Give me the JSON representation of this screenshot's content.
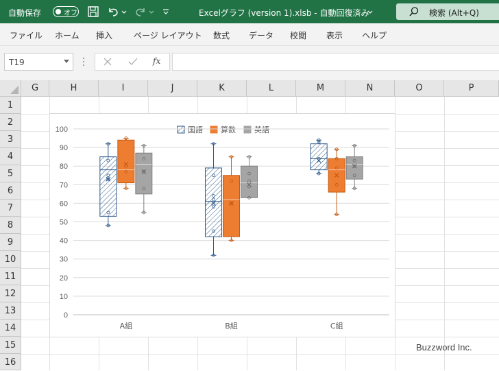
{
  "titlebar": {
    "autosave_label": "自動保存",
    "autosave_state": "オフ",
    "file_title": "Excelグラフ (version 1).xlsb  -  自動回復済み",
    "search_label": "検索 (Alt+Q)"
  },
  "menu": [
    "ファイル",
    "ホーム",
    "挿入",
    "ページ レイアウト",
    "数式",
    "データ",
    "校閲",
    "表示",
    "ヘルプ"
  ],
  "formula_bar": {
    "name_box": "T19",
    "fx_label": "fx",
    "formula": ""
  },
  "columns": [
    "G",
    "H",
    "I",
    "J",
    "K",
    "L",
    "M",
    "N",
    "O",
    "P"
  ],
  "rows": [
    "1",
    "2",
    "3",
    "4",
    "5",
    "6",
    "7",
    "8",
    "9",
    "10",
    "11",
    "12",
    "13",
    "14",
    "15",
    "16"
  ],
  "chart_data": {
    "type": "boxplot",
    "categories": [
      "A組",
      "B組",
      "C組"
    ],
    "ylim": [
      0,
      100
    ],
    "yticks": [
      "0",
      "10",
      "20",
      "30",
      "40",
      "50",
      "60",
      "70",
      "80",
      "90",
      "100"
    ],
    "legend_position": "top",
    "grid": true,
    "series": [
      {
        "name": "国語",
        "color": "#2e5a8a",
        "pattern": "hatch",
        "boxes": [
          {
            "min": 48,
            "q1": 53,
            "median": 78,
            "q3": 85,
            "max": 92,
            "mean": 73,
            "points": [
              48,
              55,
              73,
              75,
              83,
              92
            ]
          },
          {
            "min": 32,
            "q1": 42,
            "median": 61,
            "q3": 79,
            "max": 92,
            "mean": 60,
            "points": [
              32,
              45,
              58,
              62,
              64,
              75,
              92
            ]
          },
          {
            "min": 76,
            "q1": 78,
            "median": 84,
            "q3": 92,
            "max": 94,
            "mean": 83,
            "points": [
              76,
              84,
              93,
              94
            ]
          }
        ]
      },
      {
        "name": "算数",
        "color": "#ed7d31",
        "pattern": "solid",
        "boxes": [
          {
            "min": 68,
            "q1": 71,
            "median": 78,
            "q3": 94,
            "max": 95,
            "mean": 81,
            "points": [
              68,
              77,
              80,
              95
            ]
          },
          {
            "min": 40,
            "q1": 42,
            "median": 62,
            "q3": 75,
            "max": 85,
            "mean": 60,
            "points": [
              40,
              60,
              72,
              85
            ]
          },
          {
            "min": 54,
            "q1": 66,
            "median": 78,
            "q3": 84,
            "max": 89,
            "mean": 75,
            "points": [
              54,
              70,
              79,
              84,
              89
            ]
          }
        ]
      },
      {
        "name": "英語",
        "color": "#a5a5a5",
        "pattern": "solid",
        "boxes": [
          {
            "min": 55,
            "q1": 65,
            "median": 81,
            "q3": 87,
            "max": 91,
            "mean": 77,
            "points": [
              55,
              68,
              77,
              84,
              91
            ]
          },
          {
            "min": 63,
            "q1": 63,
            "median": 71,
            "q3": 80,
            "max": 85,
            "mean": 70,
            "points": [
              63,
              69,
              72,
              76,
              85
            ]
          },
          {
            "min": 68,
            "q1": 73,
            "median": 81,
            "q3": 85,
            "max": 91,
            "mean": 80,
            "points": [
              68,
              75,
              80,
              83,
              91
            ]
          }
        ]
      }
    ]
  },
  "watermark": "Buzzword Inc."
}
